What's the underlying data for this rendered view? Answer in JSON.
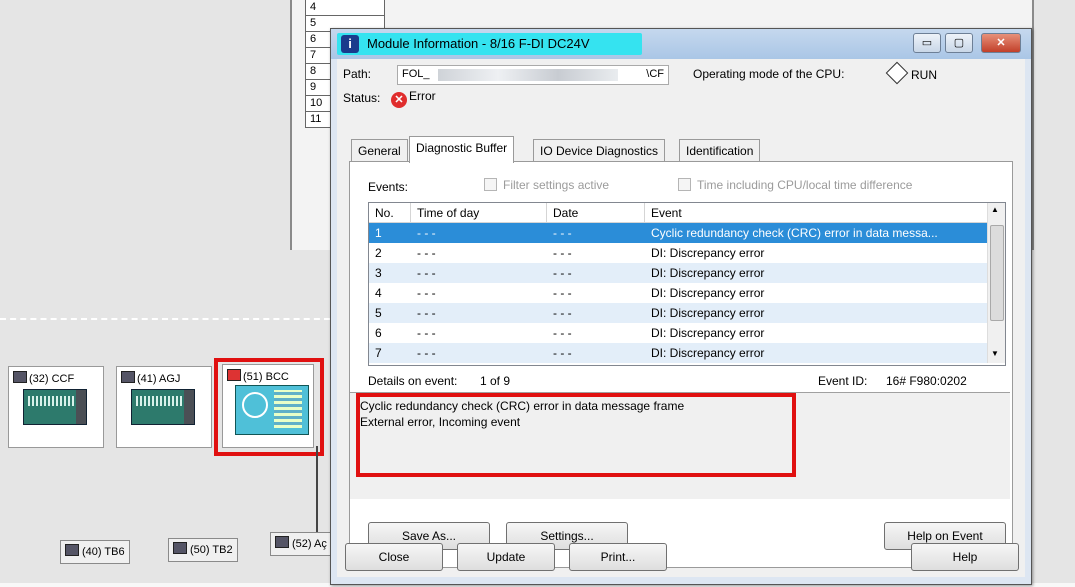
{
  "background": {
    "slot_numbers": [
      "4",
      "5",
      "6",
      "7",
      "8",
      "9",
      "10",
      "11"
    ],
    "devices": [
      {
        "label": "(32) CCF"
      },
      {
        "label": "(41) AGJ"
      },
      {
        "label": "(51) BCC"
      }
    ],
    "bottom_devices": [
      {
        "label": "(40) TB6"
      },
      {
        "label": "(50) TB2"
      },
      {
        "label": "(52) Aç"
      }
    ]
  },
  "dialog": {
    "title": "Module Information - 8/16 F-DI DC24V",
    "title_icon": "info-icon",
    "window_buttons": {
      "minimize": "▭",
      "maximize": "▢",
      "close": "✕"
    },
    "path_label": "Path:",
    "path_value_start": "FOL_",
    "path_value_end": "\\CF",
    "operating_mode_label": "Operating mode of the  CPU:",
    "operating_mode_value": "RUN",
    "status_label": "Status:",
    "status_value": "Error",
    "tabs": [
      {
        "label": "General",
        "active": false
      },
      {
        "label": "Diagnostic Buffer",
        "active": true
      },
      {
        "label": "IO Device Diagnostics",
        "active": false
      },
      {
        "label": "Identification",
        "active": false
      }
    ],
    "events_label": "Events:",
    "filter_label": "Filter settings active",
    "time_including_label": "Time including CPU/local time difference",
    "table": {
      "columns": [
        "No.",
        "Time of day",
        "Date",
        "Event"
      ],
      "rows": [
        {
          "no": "1",
          "time": "- - -",
          "date": "- - -",
          "event": "Cyclic redundancy check (CRC) error in data messa..."
        },
        {
          "no": "2",
          "time": "- - -",
          "date": "- - -",
          "event": "DI: Discrepancy error"
        },
        {
          "no": "3",
          "time": "- - -",
          "date": "- - -",
          "event": "DI: Discrepancy error"
        },
        {
          "no": "4",
          "time": "- - -",
          "date": "- - -",
          "event": "DI: Discrepancy error"
        },
        {
          "no": "5",
          "time": "- - -",
          "date": "- - -",
          "event": "DI: Discrepancy error"
        },
        {
          "no": "6",
          "time": "- - -",
          "date": "- - -",
          "event": "DI: Discrepancy error"
        },
        {
          "no": "7",
          "time": "- - -",
          "date": "- - -",
          "event": "DI: Discrepancy error"
        }
      ],
      "selected_row": 1
    },
    "details_label": "Details on event:",
    "details_position": "1 of 9",
    "event_id_label": "Event ID:",
    "event_id_value": "16# F980:0202",
    "details_lines": [
      "Cyclic redundancy check (CRC) error in data message frame",
      "External error, Incoming event"
    ],
    "buttons": {
      "save_as": "Save As...",
      "settings": "Settings...",
      "help_on_event": "Help on Event",
      "close": "Close",
      "update": "Update",
      "print": "Print...",
      "help": "Help"
    }
  },
  "colors": {
    "title_highlight": "#35e3f0",
    "selection": "#2b8dd8",
    "alt_row": "#e3eef9",
    "annotation_red": "#e01010",
    "error_icon": "#e02d2d"
  }
}
